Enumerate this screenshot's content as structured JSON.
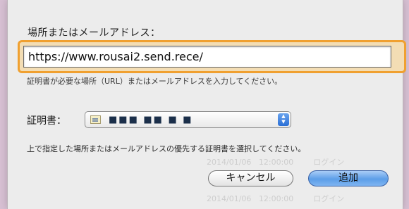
{
  "dialog": {
    "address_label": "場所またはメールアドレス：",
    "address_value": "https://www.rousai2.send.rece/",
    "hint_text": "証明書が必要な場所（URL）またはメールアドレスを入力してください。",
    "certificate_label": "証明書：",
    "certificate_value": "■■■ ■■ ■ ■",
    "certificate_icon": "certificate-icon",
    "description": "上で指定した場所またはメールアドレスの優先する証明書を選択してください。",
    "cancel_label": "キャンセル",
    "add_label": "追加"
  },
  "colors": {
    "focus_ring": "#f0a030",
    "default_button": "#5c9ee8",
    "background": "#d7c0d3"
  }
}
